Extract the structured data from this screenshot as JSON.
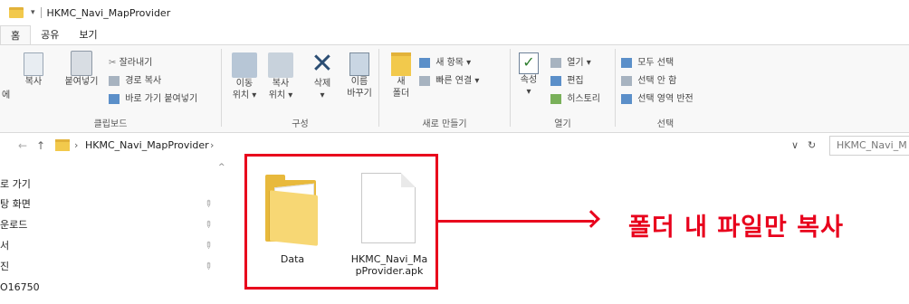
{
  "window": {
    "title": "HKMC_Navi_MapProvider",
    "qa_glyph": "▾"
  },
  "tabs": [
    "홈",
    "공유",
    "보기"
  ],
  "ribbon": {
    "clipboard": {
      "label": "클립보드",
      "pin_fragment": "에",
      "copy": "복사",
      "paste": "붙여넣기",
      "cut": "잘라내기",
      "copy_path": "경로 복사",
      "paste_shortcut": "바로 가기 붙여넣기"
    },
    "organize": {
      "label": "구성",
      "move_to": [
        "이동",
        "위치 ▾"
      ],
      "copy_to": [
        "복사",
        "위치 ▾"
      ],
      "delete": [
        "삭제",
        "▾"
      ],
      "rename": [
        "이름",
        "바꾸기"
      ]
    },
    "new": {
      "label": "새로 만들기",
      "new_folder": [
        "새",
        "폴더"
      ],
      "new_item": "새 항목 ▾",
      "easy_access": "빠른 연결 ▾"
    },
    "open": {
      "label": "열기",
      "properties": [
        "속성",
        "▾"
      ],
      "open": "열기 ▾",
      "edit": "편집",
      "history": "히스토리"
    },
    "select": {
      "label": "선택",
      "select_all": "모두 선택",
      "select_none": "선택 안 함",
      "invert": "선택 영역 반전"
    }
  },
  "address": {
    "back": "←",
    "forward": "→",
    "up": "↑",
    "sep": "›",
    "path": "HKMC_Navi_MapProvider",
    "sep2": "›",
    "dropdown": "∨",
    "refresh": "↻",
    "search_placeholder": "HKMC_Navi_M"
  },
  "left_pane": {
    "scroll_up": "^",
    "items": [
      {
        "label": "로 가기",
        "pinned": false
      },
      {
        "label": "탕 화면",
        "pinned": true
      },
      {
        "label": "운로드",
        "pinned": true
      },
      {
        "label": "서",
        "pinned": true
      },
      {
        "label": "진",
        "pinned": true
      },
      {
        "label": "O16750",
        "pinned": false
      }
    ],
    "pin_glyph": "📌"
  },
  "files": [
    {
      "name": "Data",
      "type": "folder"
    },
    {
      "name_lines": [
        "HKMC_Navi_Ma",
        "pProvider.apk"
      ],
      "type": "file"
    }
  ],
  "annotation": {
    "text": "폴더 내 파일만 복사",
    "color": "#e8001c"
  },
  "colors": {
    "ribbon_bg": "#f8f8f8",
    "folder_yellow": "#f2c94c",
    "accent_red": "#e8001c"
  }
}
